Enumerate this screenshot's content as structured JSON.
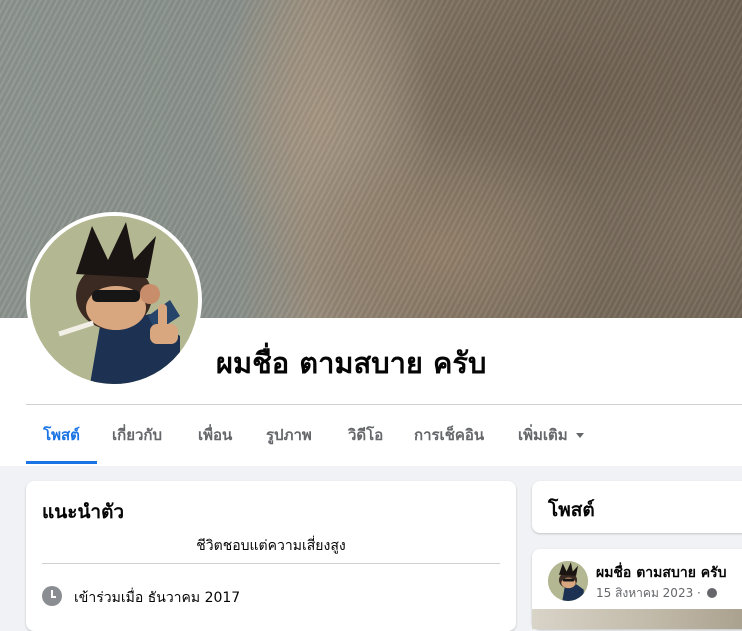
{
  "profile": {
    "name": "ผมชื่อ ตามสบาย ครับ"
  },
  "tabs": [
    {
      "label": "โพสต์",
      "active": true
    },
    {
      "label": "เกี่ยวกับ",
      "active": false
    },
    {
      "label": "เพื่อน",
      "active": false
    },
    {
      "label": "รูปภาพ",
      "active": false
    },
    {
      "label": "วิดีโอ",
      "active": false
    },
    {
      "label": "การเช็คอิน",
      "active": false
    },
    {
      "label": "เพิ่มเติม",
      "active": false,
      "has_dropdown": true
    }
  ],
  "intro": {
    "title": "แนะนำตัว",
    "bio": "ชีวิตชอบแต่ความเสี่ยงสูง",
    "joined": "เข้าร่วมเมื่อ ธันวาคม 2017",
    "joined_icon": "clock-icon"
  },
  "posts": {
    "title": "โพสต์",
    "first_post": {
      "author": "ผมชื่อ ตามสบาย ครับ",
      "date": "15 สิงหาคม 2023 ·",
      "privacy_icon": "globe-icon"
    }
  },
  "colors": {
    "accent": "#1b74e4",
    "background": "#f0f2f5",
    "secondary_text": "#65676b"
  }
}
